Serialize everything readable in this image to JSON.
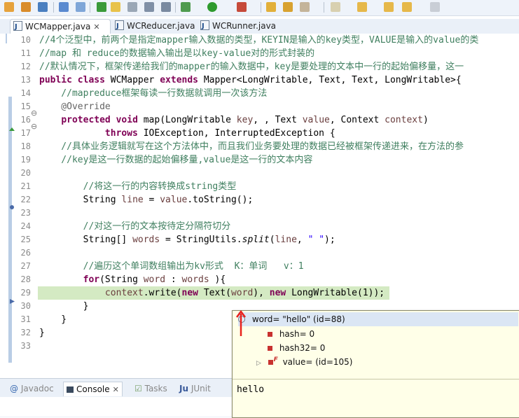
{
  "editor_tabs": [
    {
      "label": "WCMapper.java",
      "close": "✕",
      "active": true
    },
    {
      "label": "WCReducer.java",
      "active": false
    },
    {
      "label": "WCRunner.java",
      "active": false
    }
  ],
  "line_numbers": [
    "10",
    "11",
    "12",
    "13",
    "14",
    "15",
    "16",
    "17",
    "18",
    "19",
    "20",
    "21",
    "22",
    "23",
    "24",
    "25",
    "26",
    "27",
    "28",
    "29",
    "30",
    "31",
    "32",
    "33"
  ],
  "fold_markers": {
    "15": "⊖",
    "16": "⊖"
  },
  "code": {
    "l10": "//4个泛型中，前两个是指定mapper输入数据的类型，KEYIN是输入的key类型，VALUE是输入的value的类",
    "l11": "//map 和 reduce的数据输入输出是以key-value对的形式封装的",
    "l12": "//默认情况下，框架传递给我们的mapper的输入数据中，key是要处理的文本中一行的起始偏移量，这一",
    "l13": {
      "kw1": "public",
      "kw2": "class",
      "name": " WCMapper ",
      "kw3": "extends",
      "rest": " Mapper<LongWritable, Text, Text, LongWritable>{"
    },
    "l14": "    //mapreduce框架每读一行数据就调用一次该方法",
    "l15": "    @Override",
    "l16": {
      "indent": "    ",
      "kw1": "protected",
      "kw2": "void",
      "sig": " map(LongWritable ",
      "p1": "key",
      ", ": ", ",
      "t2": "Text ",
      "p2": "value",
      "c2": ", Context ",
      "p3": "context",
      ")": ")"
    },
    "l17": {
      "indent": "            ",
      "kw": "throws",
      "rest": " IOException, InterruptedException {"
    },
    "l18": "    //具体业务逻辑就写在这个方法体中，而且我们业务要处理的数据已经被框架传递进来，在方法的参",
    "l19": "    //key是这一行数据的起始偏移量,value是这一行的文本内容",
    "l20": "",
    "l21": "        //将这一行的内容转换成string类型",
    "l22": {
      "indent": "        ",
      "a": "String ",
      "v1": "line",
      " = ": " = ",
      "v2": "value",
      ".toString();": ".toString();"
    },
    "l23": "",
    "l24": "        //对这一行的文本按待定分隔符切分",
    "l25": {
      "indent": "        ",
      "a": "String[] ",
      "v1": "words",
      " = StringUtils.": " = StringUtils.",
      "m": "split",
      "(": "(",
      "v2": "line",
      ", ": ", ",
      "s": "\" \"",
      "end": ");"
    },
    "l26": "",
    "l27": "        //遍历这个单词数组输出为kv形式  K：单词   v：1",
    "l28": {
      "indent": "        ",
      "kw": "for",
      "a": "(String ",
      "v1": "word",
      " : ": " : ",
      "v2": "words",
      "end": " ){"
    },
    "l29": {
      "indent": "            ",
      "v1": "context",
      ".write(": ".write(",
      "kw1": "new",
      "t": " Text(",
      "v2": "word",
      "c": "), ",
      "kw2": "new",
      "rest": " LongWritable(1));"
    },
    "l30": "        }",
    "l31": "    }",
    "l32": "}",
    "l33": ""
  },
  "debug_hover": {
    "root": "word= \"hello\" (id=88)",
    "children": [
      "hash= 0",
      "hash32= 0",
      "value= (id=105)"
    ],
    "detail": "hello"
  },
  "bottom_tabs": [
    {
      "label": "Javadoc",
      "active": false
    },
    {
      "label": "Console",
      "active": true
    },
    {
      "label": "Tasks",
      "active": false
    },
    {
      "label": "JUnit",
      "active": false
    }
  ],
  "colors": {
    "comment": "#3f7f5f",
    "keyword": "#7f0055",
    "variable": "#6a3e3e",
    "string": "#2a00ff",
    "current_line": "#d4eac3",
    "arrow": "#e8211c"
  }
}
